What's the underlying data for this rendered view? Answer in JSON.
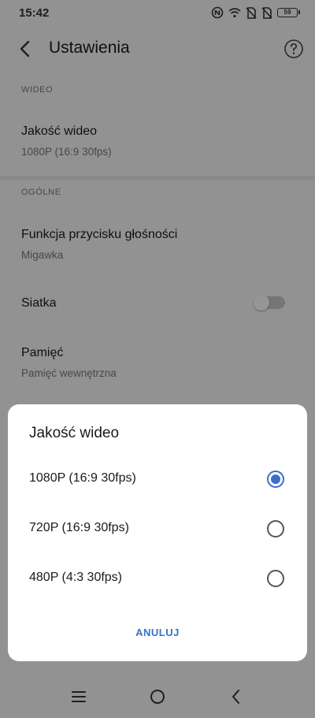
{
  "status_bar": {
    "time": "15:42",
    "battery": "59",
    "icons": [
      "nfc-icon",
      "wifi-icon",
      "no-sim-icon",
      "no-sim-icon",
      "battery-icon"
    ]
  },
  "app_bar": {
    "title": "Ustawienia",
    "back_icon": "chevron-left-icon",
    "help_icon": "help-circle-icon"
  },
  "sections": {
    "video": {
      "header": "WIDEO",
      "video_quality": {
        "title": "Jakość wideo",
        "value": "1080P (16:9  30fps)"
      }
    },
    "general": {
      "header": "OGÓLNE",
      "volume_button": {
        "title": "Funkcja przycisku głośności",
        "value": "Migawka"
      },
      "grid": {
        "title": "Siatka",
        "enabled": false
      },
      "storage": {
        "title": "Pamięć",
        "value": "Pamięć wewnętrzna"
      }
    }
  },
  "dialog": {
    "title": "Jakość wideo",
    "options": [
      {
        "label": "1080P (16:9  30fps)",
        "selected": true
      },
      {
        "label": "720P (16:9  30fps)",
        "selected": false
      },
      {
        "label": "480P (4:3  30fps)",
        "selected": false
      }
    ],
    "cancel_label": "ANULUJ",
    "accent_color": "#3b6fc9"
  },
  "nav_bar": {
    "icons": [
      "menu-icon",
      "home-icon",
      "back-icon"
    ]
  }
}
